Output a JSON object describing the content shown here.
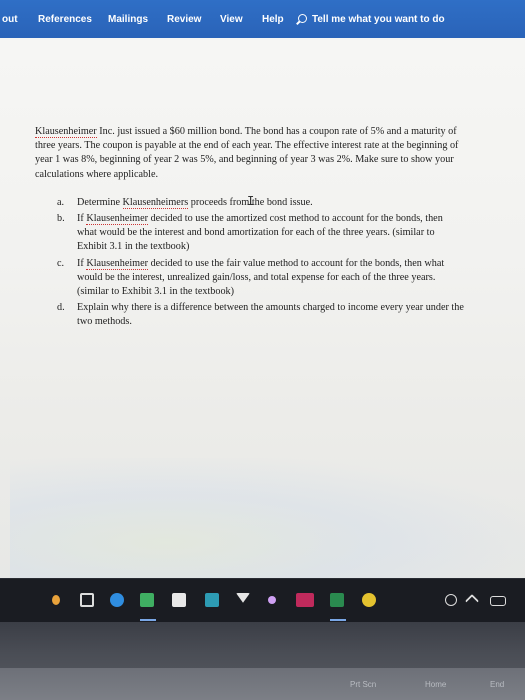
{
  "ribbon": {
    "tabs": [
      "out",
      "References",
      "Mailings",
      "Review",
      "View",
      "Help"
    ],
    "tell_me": "Tell me what you want to do"
  },
  "document": {
    "intro_name": "Klausenheimer",
    "intro_rest": " Inc. just issued a $60 million bond. The bond has a coupon rate of 5% and a maturity of three years. The coupon is payable at the end of each year. The effective interest rate at the beginning of year 1 was 8%, beginning of year 2 was 5%, and beginning of year 3 was 2%. Make sure to show your calculations where applicable.",
    "items": [
      {
        "marker": "a.",
        "pre": "Determine ",
        "name": "Klausenheimers",
        "post": " proceeds from the bond issue."
      },
      {
        "marker": "b.",
        "pre": "If ",
        "name": "Klausenheimer",
        "post": " decided to use the amortized cost method to account for the bonds, then what would be the interest and bond amortization for each of the three years. (similar to Exhibit 3.1 in the textbook)"
      },
      {
        "marker": "c.",
        "pre": "If ",
        "name": "Klausenheimer",
        "post": " decided to use the fair value method to account for the bonds, then what would be the interest, unrealized gain/loss, and total expense for each of the three years. (similar to Exhibit 3.1 in the textbook)"
      },
      {
        "marker": "d.",
        "pre": "",
        "name": "",
        "post": "Explain why there is a difference between the amounts charged to income every year under the two methods."
      }
    ]
  },
  "taskbar": {
    "icons": [
      "task-view-icon",
      "edge-icon",
      "store-icon",
      "calendar-icon",
      "photos-icon",
      "mail-icon",
      "weather-icon",
      "onenote-icon",
      "excel-icon",
      "chrome-icon"
    ],
    "colors": {
      "accent": "#2b63b8",
      "taskbar": "#1a1c22"
    }
  },
  "keyboard": {
    "keys": [
      "Prt Scn",
      "Home",
      "End"
    ]
  }
}
